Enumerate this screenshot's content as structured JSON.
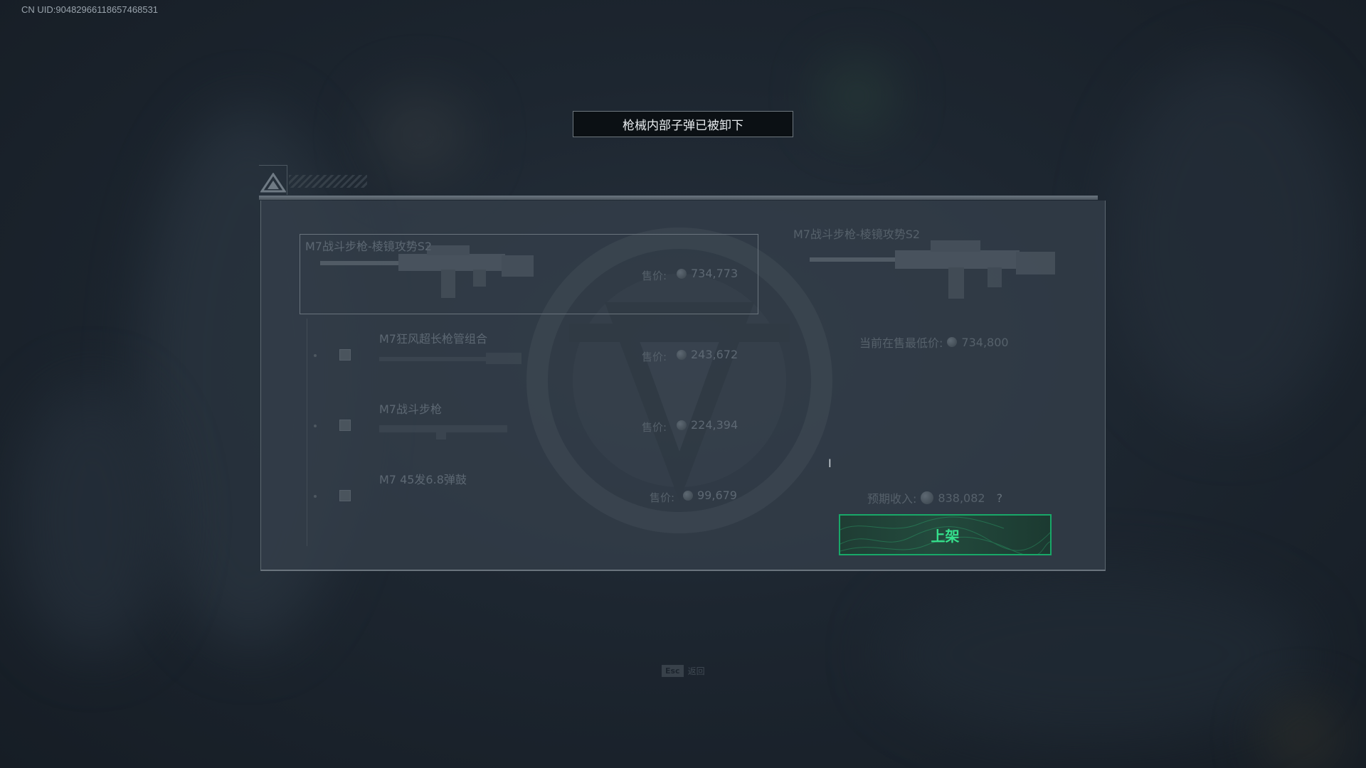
{
  "uid": "CN UID:9048296611865746853​1",
  "toast": "枪械内部子弹已被卸下",
  "selected_item": {
    "name": "M7战斗步枪-棱镜攻势S2",
    "price_label": "售价:",
    "price": "734,773"
  },
  "sub_items": [
    {
      "name": "M7狂风超长枪管组合",
      "price_label": "售价:",
      "price": "243,672"
    },
    {
      "name": "M7战斗步枪",
      "price_label": "售价:",
      "price": "224,394"
    },
    {
      "name": "M7 45发6.8弹鼓",
      "price_label": "售价:",
      "price": "99,679"
    }
  ],
  "right_panel": {
    "name": "M7战斗步枪-棱镜攻势S2",
    "lowest_label": "当前在售最低价:",
    "lowest_price": "734,800",
    "income_label": "预期收入:",
    "income": "838,082",
    "help": "?",
    "list_button": "上架"
  },
  "bottom_hint": {
    "key": "Esc",
    "label": "返回"
  },
  "colors": {
    "accent": "#18a868",
    "button_text": "#35e08c"
  },
  "icons": [
    "triangle-logo-icon",
    "coin-icon",
    "emblem-icon",
    "rifle-icon",
    "text-cursor-icon"
  ]
}
